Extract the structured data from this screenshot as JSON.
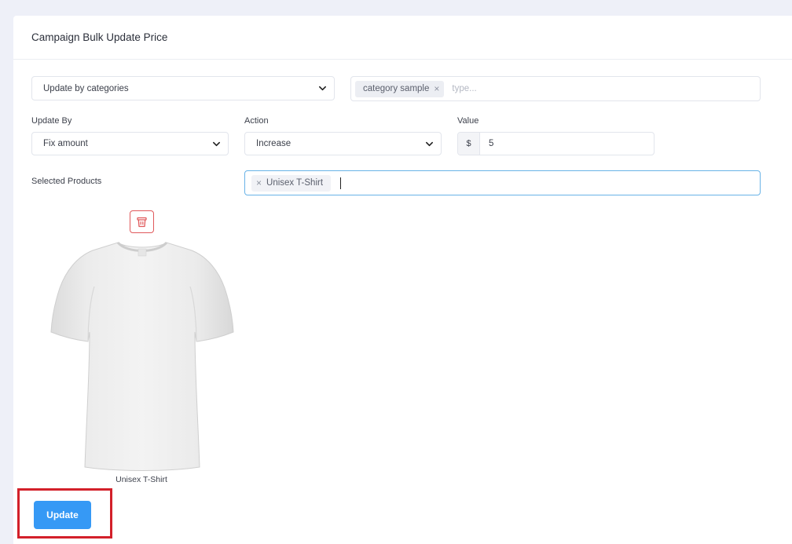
{
  "page": {
    "title": "Campaign Bulk Update Price"
  },
  "filter": {
    "mode_select": "Update by categories",
    "category_tag": "category sample",
    "category_placeholder": "type..."
  },
  "update_by": {
    "label": "Update By",
    "value": "Fix amount"
  },
  "action": {
    "label": "Action",
    "value": "Increase"
  },
  "value_field": {
    "label": "Value",
    "prefix": "$",
    "value": "5"
  },
  "selected_products": {
    "label": "Selected Products",
    "tags": [
      "Unisex T-Shirt"
    ]
  },
  "product_card": {
    "name": "Unisex T-Shirt"
  },
  "update_button": {
    "label": "Update"
  },
  "colors": {
    "primary": "#3699f5",
    "danger": "#e0595b",
    "highlight": "#d3202a",
    "focus_border": "#69b3e7"
  }
}
